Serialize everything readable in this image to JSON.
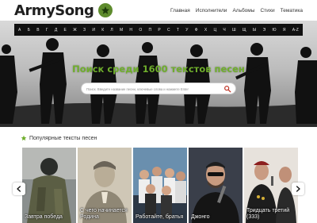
{
  "header": {
    "logo_text": "ArmySong",
    "logo_icon": "star-icon",
    "nav": [
      "Главная",
      "Исполнители",
      "Альбомы",
      "Стихи",
      "Тематика"
    ]
  },
  "alphabet": [
    "А",
    "Б",
    "В",
    "Г",
    "Д",
    "Е",
    "Ж",
    "З",
    "И",
    "К",
    "Л",
    "М",
    "Н",
    "О",
    "П",
    "Р",
    "С",
    "Т",
    "У",
    "Ф",
    "Х",
    "Ц",
    "Ч",
    "Ш",
    "Щ",
    "Ы",
    "Э",
    "Ю",
    "Я",
    "A-Z"
  ],
  "hero": {
    "title": "Поиск среди 1600 текстов песен",
    "search_placeholder": "Поиск. Введите название песни, ключевые слова и нажмите Enter"
  },
  "popular": {
    "title": "Популярные тексты песен",
    "cards": [
      {
        "title": "Завтра победа"
      },
      {
        "title": "С чего начинается Родина"
      },
      {
        "title": "Работайте, братья"
      },
      {
        "title": "Джонго"
      },
      {
        "title": "Тридцать третий (333)"
      }
    ]
  },
  "colors": {
    "accent_green": "#6fae2c",
    "logo_star": "#5e8b2d",
    "search_icon": "#c0392b"
  }
}
